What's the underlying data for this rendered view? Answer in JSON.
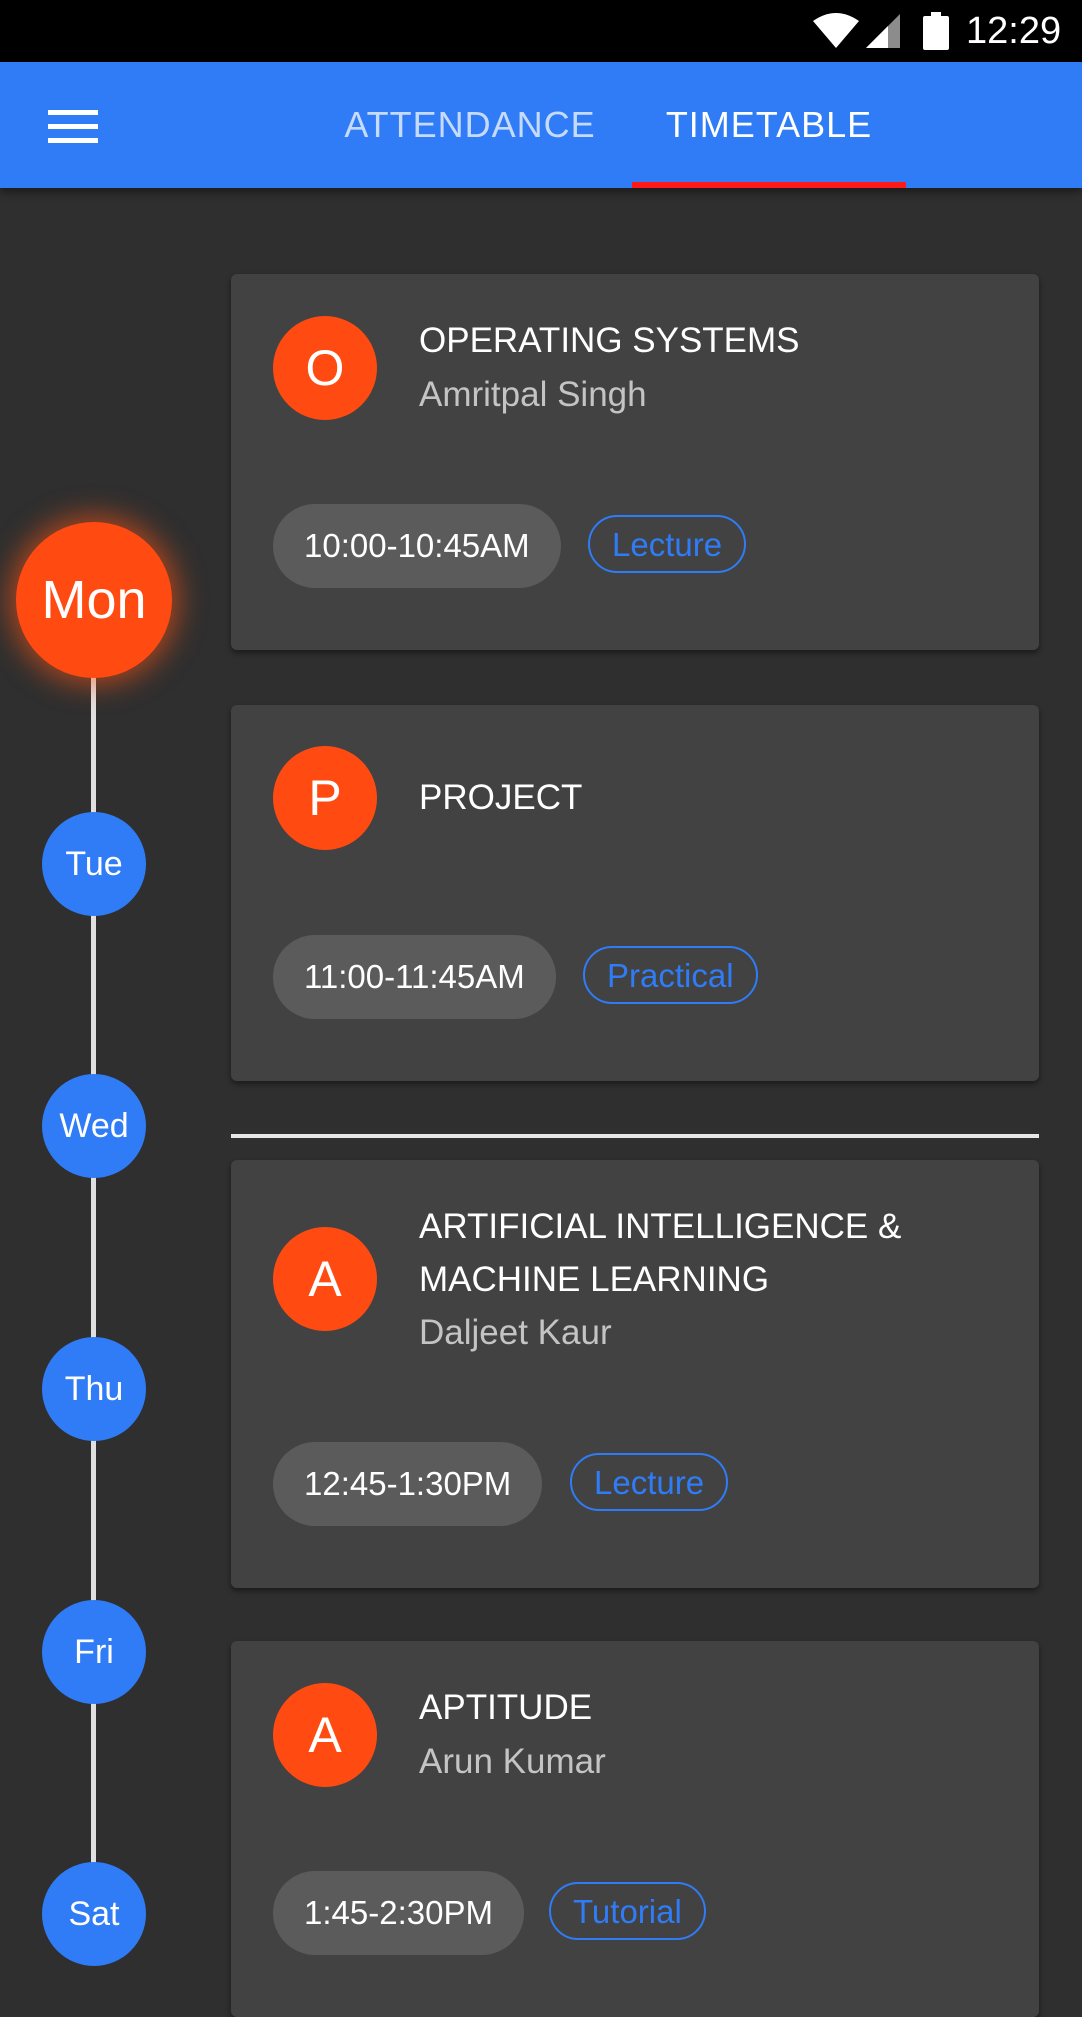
{
  "status_bar": {
    "time": "12:29",
    "icons": [
      "wifi-icon",
      "cell-signal-icon",
      "battery-icon"
    ]
  },
  "app_bar": {
    "menu_icon": "hamburger-menu-icon",
    "tabs": [
      {
        "label": "ATTENDANCE",
        "selected": false
      },
      {
        "label": "TIMETABLE",
        "selected": true
      }
    ]
  },
  "colors": {
    "app_bar": "#2f7cf6",
    "accent": "#ff4b12",
    "tab_indicator": "#ff1a1a",
    "background": "#2f2f2f",
    "card": "#424242"
  },
  "days": [
    {
      "label": "Mon",
      "selected": true
    },
    {
      "label": "Tue",
      "selected": false
    },
    {
      "label": "Wed",
      "selected": false
    },
    {
      "label": "Thu",
      "selected": false
    },
    {
      "label": "Fri",
      "selected": false
    },
    {
      "label": "Sat",
      "selected": false
    }
  ],
  "classes": [
    {
      "initial": "O",
      "title": "OPERATING SYSTEMS",
      "instructor": "Amritpal Singh",
      "time": "10:00-10:45AM",
      "type": "Lecture"
    },
    {
      "initial": "P",
      "title": "PROJECT",
      "instructor": "",
      "time": "11:00-11:45AM",
      "type": "Practical"
    },
    {
      "initial": "A",
      "title": "ARTIFICIAL INTELLIGENCE & MACHINE LEARNING",
      "instructor": "Daljeet Kaur",
      "time": "12:45-1:30PM",
      "type": "Lecture"
    },
    {
      "initial": "A",
      "title": "APTITUDE",
      "instructor": "Arun Kumar",
      "time": "1:45-2:30PM",
      "type": "Tutorial"
    }
  ]
}
